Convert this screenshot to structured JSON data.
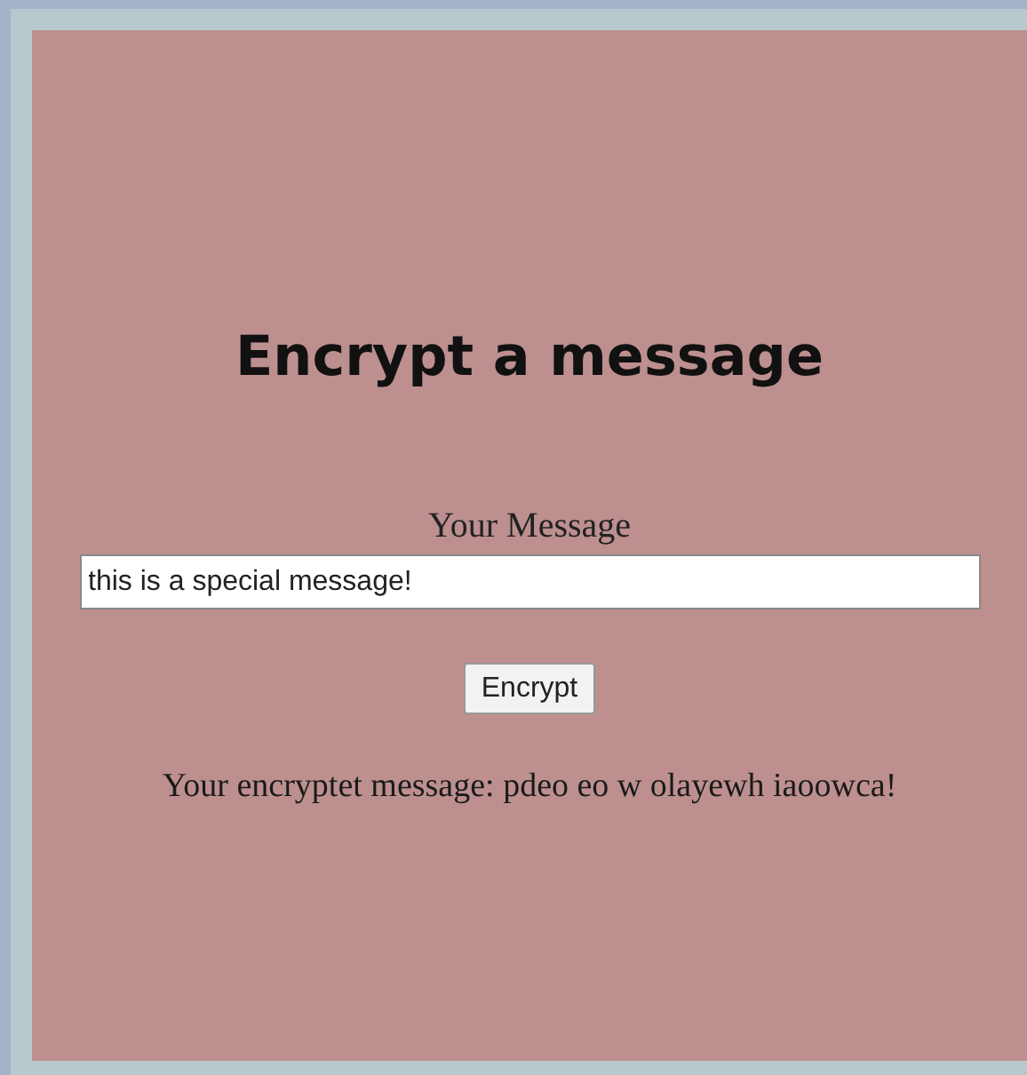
{
  "heading": "Encrypt a message",
  "message_field": {
    "label": "Your Message",
    "value": "this is a special message!"
  },
  "encrypt_button": "Encrypt",
  "result": "Your encryptet message: pdeo eo w olayewh iaoowca!"
}
